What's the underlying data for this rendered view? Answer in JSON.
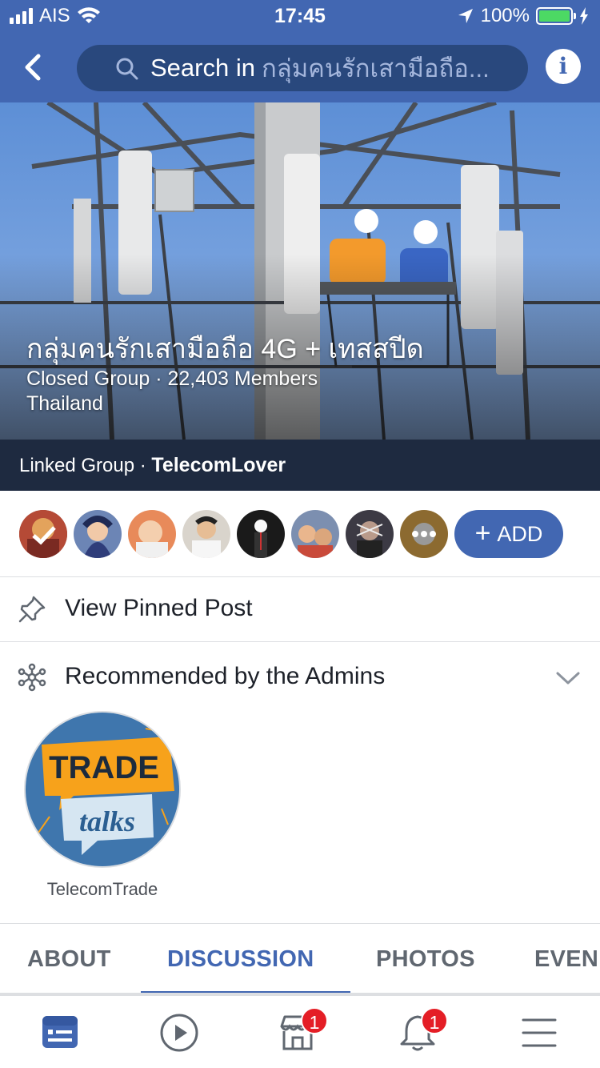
{
  "status_bar": {
    "carrier": "AIS",
    "time": "17:45",
    "battery": "100%"
  },
  "nav": {
    "search_prefix": "Search in",
    "search_group": "กลุ่มคนรักเสามือถือ..."
  },
  "group": {
    "name": "กลุ่มคนรักเสามือถือ 4G + เทสสปีด",
    "privacy_members": "Closed Group · 22,403 Members",
    "location": "Thailand",
    "linked_prefix": "Linked Group · ",
    "linked_name": "TelecomLover"
  },
  "members_bar": {
    "add_label": "ADD"
  },
  "pinned": {
    "label": "View Pinned Post"
  },
  "recommended": {
    "label": "Recommended by the Admins",
    "item_label": "TelecomTrade",
    "logo_word1": "TRADE",
    "logo_word2": "talks"
  },
  "tabs": [
    "ABOUT",
    "DISCUSSION",
    "PHOTOS",
    "EVEN"
  ],
  "active_tab": "DISCUSSION",
  "bottom_nav": {
    "marketplace_badge": "1",
    "notifications_badge": "1"
  },
  "colors": {
    "brand": "#4267b2",
    "badge": "#e41e26",
    "linked_bar": "#1e2a40"
  }
}
